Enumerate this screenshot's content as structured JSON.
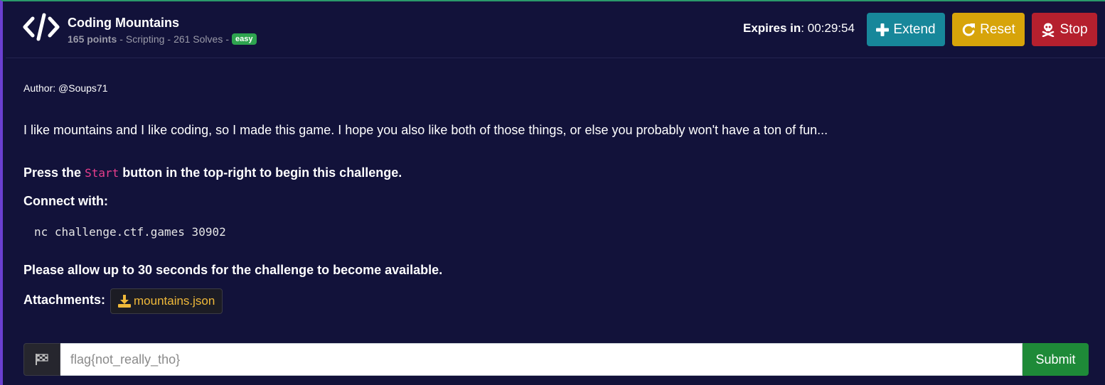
{
  "challenge": {
    "title": "Coding Mountains",
    "points": "165 points",
    "category": "Scripting",
    "solves": "261 Solves",
    "separator": "-",
    "difficulty": "easy"
  },
  "timer": {
    "label": "Expires in",
    "colon": ":",
    "value": "00:29:54"
  },
  "actions": {
    "extend_label": "Extend",
    "reset_label": "Reset",
    "stop_label": "Stop"
  },
  "content": {
    "author": "Author: @Soups71",
    "description": "I like mountains and I like coding, so I made this game. I hope you also like both of those things, or else you probably won't have a ton of fun...",
    "press_prefix": "Press the",
    "press_code": "Start",
    "press_suffix": "button in the top-right to begin this challenge.",
    "connect_label": "Connect with:",
    "command": "nc challenge.ctf.games 30902",
    "allow_text": "Please allow up to 30 seconds for the challenge to become available.",
    "attachments_label": "Attachments:",
    "attachment_file": "mountains.json"
  },
  "flag_form": {
    "placeholder": "flag{not_really_tho}",
    "submit_label": "Submit"
  },
  "colors": {
    "background": "#12123a",
    "extend": "#17879a",
    "reset": "#d7a40a",
    "stop": "#b5202e",
    "submit": "#1e8a38",
    "badge_easy": "#2ea44f",
    "attachment_text": "#f0b93a",
    "code_pink": "#e83e8c"
  },
  "icons": {
    "logo": "code-icon",
    "extend": "plus-icon",
    "reset": "redo-icon",
    "stop": "skull-crossbones-icon",
    "attachment": "download-icon",
    "flag": "flag-checkered-icon"
  }
}
